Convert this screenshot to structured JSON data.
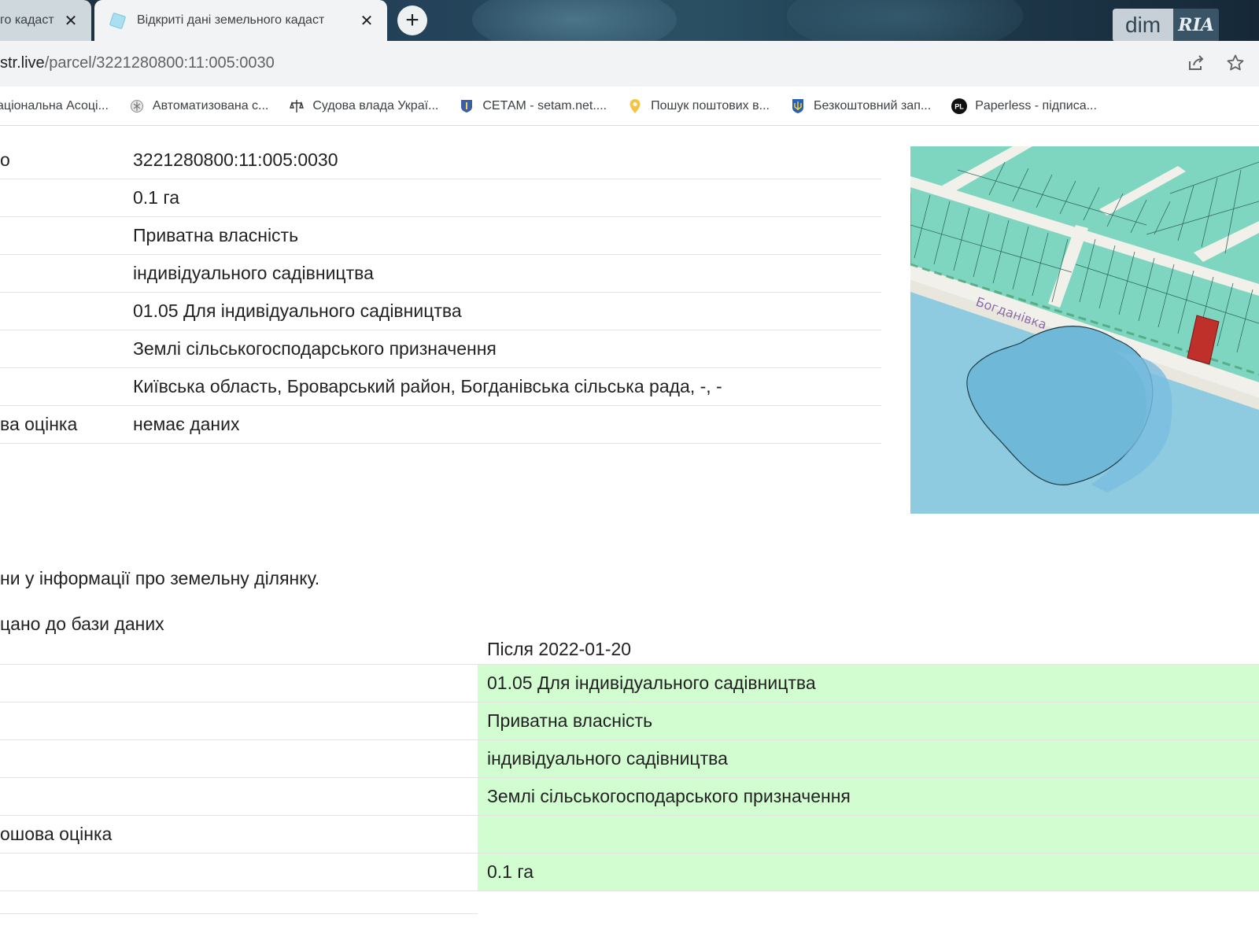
{
  "browser": {
    "tabs": [
      {
        "title": "го кадаст",
        "active": false
      },
      {
        "title": "Відкриті дані земельного кадаст",
        "active": true
      }
    ],
    "new_tab_symbol": "+",
    "close_symbol": "✕",
    "extension": {
      "dim": "dim",
      "ria": "RIA"
    },
    "url": {
      "host": "str.live",
      "path": "/parcel/3221280800:11:005:0030"
    },
    "bookmarks": [
      {
        "label": "аціональна Асоці...",
        "icon": "association-icon"
      },
      {
        "label": "Автоматизована с...",
        "icon": "emblem-icon"
      },
      {
        "label": "Судова влада Украї...",
        "icon": "justice-icon"
      },
      {
        "label": "СЕТАМ - setam.net....",
        "icon": "setam-shield-icon"
      },
      {
        "label": "Пошук поштових в...",
        "icon": "map-pin-icon"
      },
      {
        "label": "Безкоштовний зап...",
        "icon": "trident-icon"
      },
      {
        "label": "Paperless - підписа...",
        "icon": "pl-logo-icon"
      }
    ]
  },
  "parcel": {
    "rows": [
      {
        "key": "о",
        "value": "3221280800:11:005:0030"
      },
      {
        "key": "",
        "value": "0.1 га"
      },
      {
        "key": "",
        "value": "Приватна власність"
      },
      {
        "key": "",
        "value": "індивідуального садівництва"
      },
      {
        "key": "",
        "value": "01.05 Для індивідуального садівництва"
      },
      {
        "key": "",
        "value": "Землі сільськогосподарського призначення"
      },
      {
        "key": "",
        "value": "Київська область, Броварський район, Богданівська сільська рада, -, -"
      },
      {
        "key": "ва оцінка",
        "value": "немає даних"
      }
    ]
  },
  "map": {
    "street_label": "Богданівка"
  },
  "notice_text": "ни у інформації про земельну ділянку.",
  "added_text": "цано до бази даних",
  "history": {
    "after_header": "Після 2022-01-20",
    "rows": [
      {
        "left": "",
        "right": "01.05 Для індивідуального садівництва"
      },
      {
        "left": "",
        "right": "Приватна власність"
      },
      {
        "left": "",
        "right": "індивідуального садівництва"
      },
      {
        "left": "",
        "right": "Землі сільськогосподарського призначення"
      },
      {
        "left": "ошова оцінка",
        "right": ""
      },
      {
        "left": "",
        "right": "0.1 га"
      }
    ]
  },
  "colors": {
    "highlight": "#d1fdd1",
    "parcel_fill": "#7fd6c0",
    "water": "#8ecbe0",
    "selected_parcel": "#c0302a"
  }
}
